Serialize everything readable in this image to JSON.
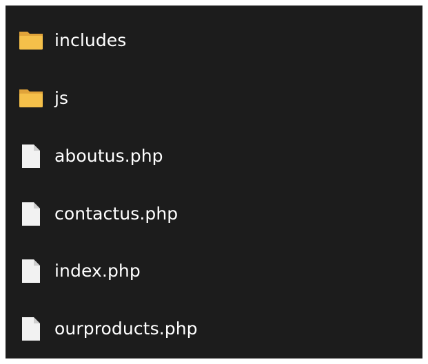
{
  "items": [
    {
      "name": "includes",
      "type": "folder",
      "icon": "folder-icon"
    },
    {
      "name": "js",
      "type": "folder",
      "icon": "folder-icon"
    },
    {
      "name": "aboutus.php",
      "type": "file",
      "icon": "file-icon"
    },
    {
      "name": "contactus.php",
      "type": "file",
      "icon": "file-icon"
    },
    {
      "name": "index.php",
      "type": "file",
      "icon": "file-icon"
    },
    {
      "name": "ourproducts.php",
      "type": "file",
      "icon": "file-icon"
    }
  ],
  "colors": {
    "background": "#1c1c1c",
    "text": "#ffffff",
    "folder": "#f5c04a",
    "file": "#f2f2f2"
  }
}
